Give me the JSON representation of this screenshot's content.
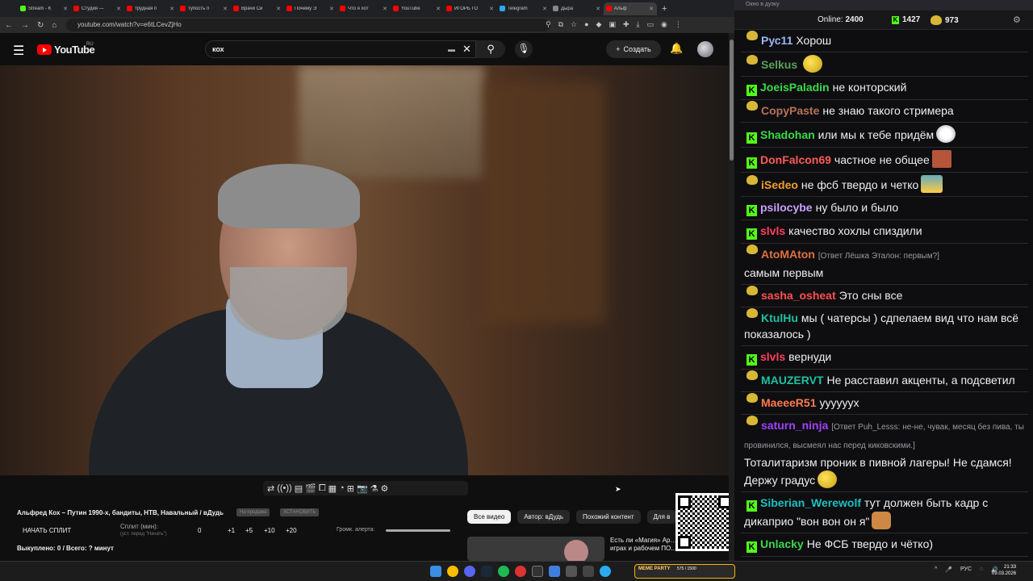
{
  "browser": {
    "tabs": [
      {
        "label": "Stream - K",
        "color": "#53fc18"
      },
      {
        "label": "Студия —",
        "color": "#ff0000"
      },
      {
        "label": "трудная п",
        "color": "#ff0000"
      },
      {
        "label": "тупость п",
        "color": "#ff0000"
      },
      {
        "label": "Врачи Си",
        "color": "#ff0000"
      },
      {
        "label": "Почему Э",
        "color": "#ff0000"
      },
      {
        "label": "Что я хот",
        "color": "#ff0000"
      },
      {
        "label": "YouTube",
        "color": "#ff0000"
      },
      {
        "label": "ИГОРЬ ГО",
        "color": "#ff0000"
      },
      {
        "label": "Telegram",
        "color": "#2aabee"
      },
      {
        "label": "Дыра",
        "color": "#888888"
      },
      {
        "label": "Альф",
        "color": "#ff0000"
      }
    ],
    "url": "youtube.com/watch?v=e6tLCevZjHo",
    "new_tab": "+",
    "window": {
      "minimize": "—",
      "maximize": "▢",
      "close": "✕"
    }
  },
  "youtube": {
    "logo": "YouTube",
    "logo_region": "RU",
    "search_value": "кох",
    "create_label": "Создать",
    "video_title": "Альфред Кох – Путин 1990-х, бандиты, НТВ, Навальный / вДудь",
    "tag_1": "На продажа",
    "tag_2": "ХСТАНОВИТЬ",
    "split_button": "НАЧАТЬ СПЛИТ",
    "split_min_label": "Сплит (мин):",
    "split_min_sub": "(уст. перед \"Начать\")",
    "split_values": [
      "0",
      "+1",
      "+5",
      "+10",
      "+20"
    ],
    "volume_label": "Громк. алерта:",
    "bought_text": "Выкуплено: 0 / Всего: ? минут",
    "chips": [
      "Все видео",
      "Автор: вДудь",
      "Похожий контент",
      "Для в"
    ],
    "rec_title": "Есть ли «Магия» Ар… Тест в играх и рабочем ПО..."
  },
  "chat": {
    "header_title": "Окно в дуэку",
    "online_label": "Online:",
    "online_count": "2400",
    "kick_count": "1427",
    "twitch_count": "973",
    "messages": [
      {
        "platform": "twitch",
        "name": "Рус11",
        "color": "#9ab6f5",
        "text": "Хорош"
      },
      {
        "platform": "twitch",
        "name": "Selkus",
        "color": "#5aa05a",
        "text": "",
        "emote": "e1"
      },
      {
        "platform": "kick",
        "name": "JoeisPaladin",
        "color": "#3cd84a",
        "text": "не конторский"
      },
      {
        "platform": "twitch",
        "name": "CopyPaste",
        "color": "#b8725a",
        "text": "не знаю такого стримера"
      },
      {
        "platform": "kick",
        "name": "Shadohan",
        "color": "#3cd84a",
        "text": "или мы к тебе придём",
        "emote": "e2"
      },
      {
        "platform": "kick",
        "name": "DonFalcon69",
        "color": "#ff5a5a",
        "text": "частное не общее",
        "emote": "e3"
      },
      {
        "platform": "twitch",
        "name": "iSedeo",
        "color": "#f0a030",
        "text": "не фсб твердо и четко",
        "emote": "e4"
      },
      {
        "platform": "kick",
        "name": "psilocybe",
        "color": "#c8a0ff",
        "text": "ну было и было"
      },
      {
        "platform": "kick",
        "name": "slvls",
        "color": "#ff4060",
        "text": "качество хохлы спиздили"
      },
      {
        "platform": "twitch",
        "name": "AtoMAton",
        "color": "#e07040",
        "reply": "[Ответ Лёшка Эталон: первым?]",
        "text": "самым первым"
      },
      {
        "platform": "twitch",
        "name": "sasha_osheat",
        "color": "#ff5050",
        "text": "Это сны все"
      },
      {
        "platform": "twitch",
        "name": "KtulHu",
        "color": "#20c0a0",
        "text": "мы ( чатерсы ) сдпелаем вид что нам всё показалось )"
      },
      {
        "platform": "kick",
        "name": "slvls",
        "color": "#ff4060",
        "text": "вернуди"
      },
      {
        "platform": "twitch",
        "name": "MAUZERVT",
        "color": "#20c0a0",
        "text": "Не расставил акценты, а подсветил"
      },
      {
        "platform": "twitch",
        "name": "MaeeeR51",
        "color": "#ff7a50",
        "text": "уууууух"
      },
      {
        "platform": "twitch",
        "name": "saturn_ninja",
        "color": "#a040ff",
        "reply": "[Ответ Puh_Lesss: не-не, чувак, месяц без пива, ты провинился, высмеял нас перед киковскими.]",
        "text": "Тоталитаризм проник в пивной лагеры! Не сдамся! Держу градус",
        "emote": "e1"
      },
      {
        "platform": "kick",
        "name": "Siberian_Werewolf",
        "color": "#20c0c0",
        "text": "тут должен быть кадр с дикаприо \"вон вон он я\"",
        "emote": "e5"
      },
      {
        "platform": "kick",
        "name": "Unlacky",
        "color": "#3cd84a",
        "text": "Не ФСБ твердо и чётко)"
      }
    ]
  },
  "taskbar": {
    "badge_text": "MEME PARTY",
    "badge_counter": "575 / 1500",
    "lang": "РУС",
    "time": "21:33",
    "date": "09.03.2026"
  }
}
